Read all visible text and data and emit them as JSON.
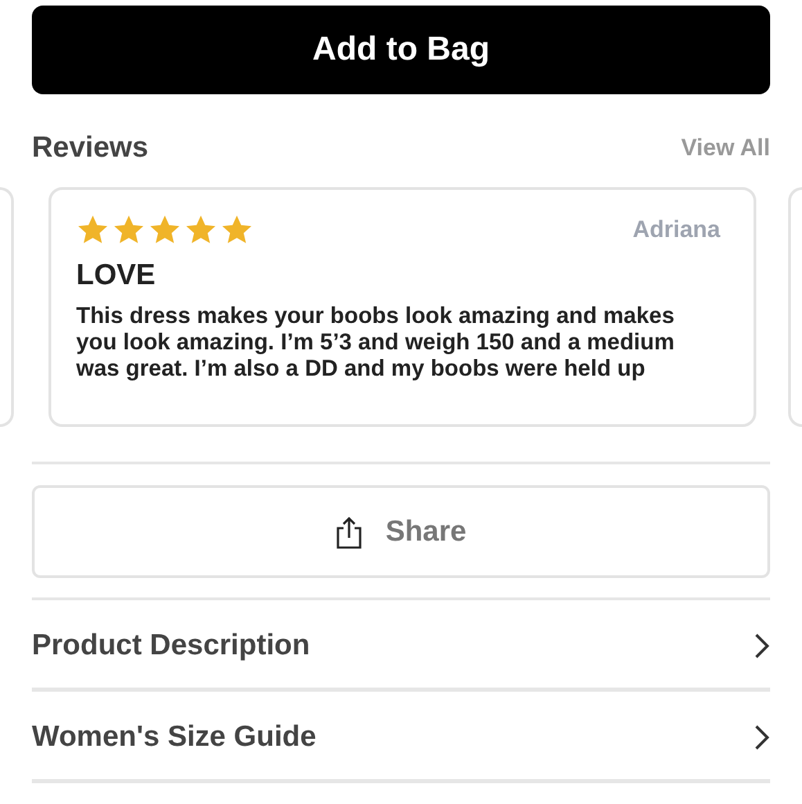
{
  "add_to_bag": {
    "label": "Add to Bag"
  },
  "reviews": {
    "title": "Reviews",
    "view_all": "View All",
    "items": [
      {
        "stars": 5,
        "author": "Adriana",
        "title": "LOVE",
        "text": "This dress makes your boobs look amazing and makes you look amazing. I’m 5’3 and weigh 150 and a medium was great. I’m also a DD and my boobs were held up"
      }
    ]
  },
  "share": {
    "label": "Share"
  },
  "sections": [
    {
      "label": "Product Description"
    },
    {
      "label": "Women's Size Guide"
    }
  ]
}
